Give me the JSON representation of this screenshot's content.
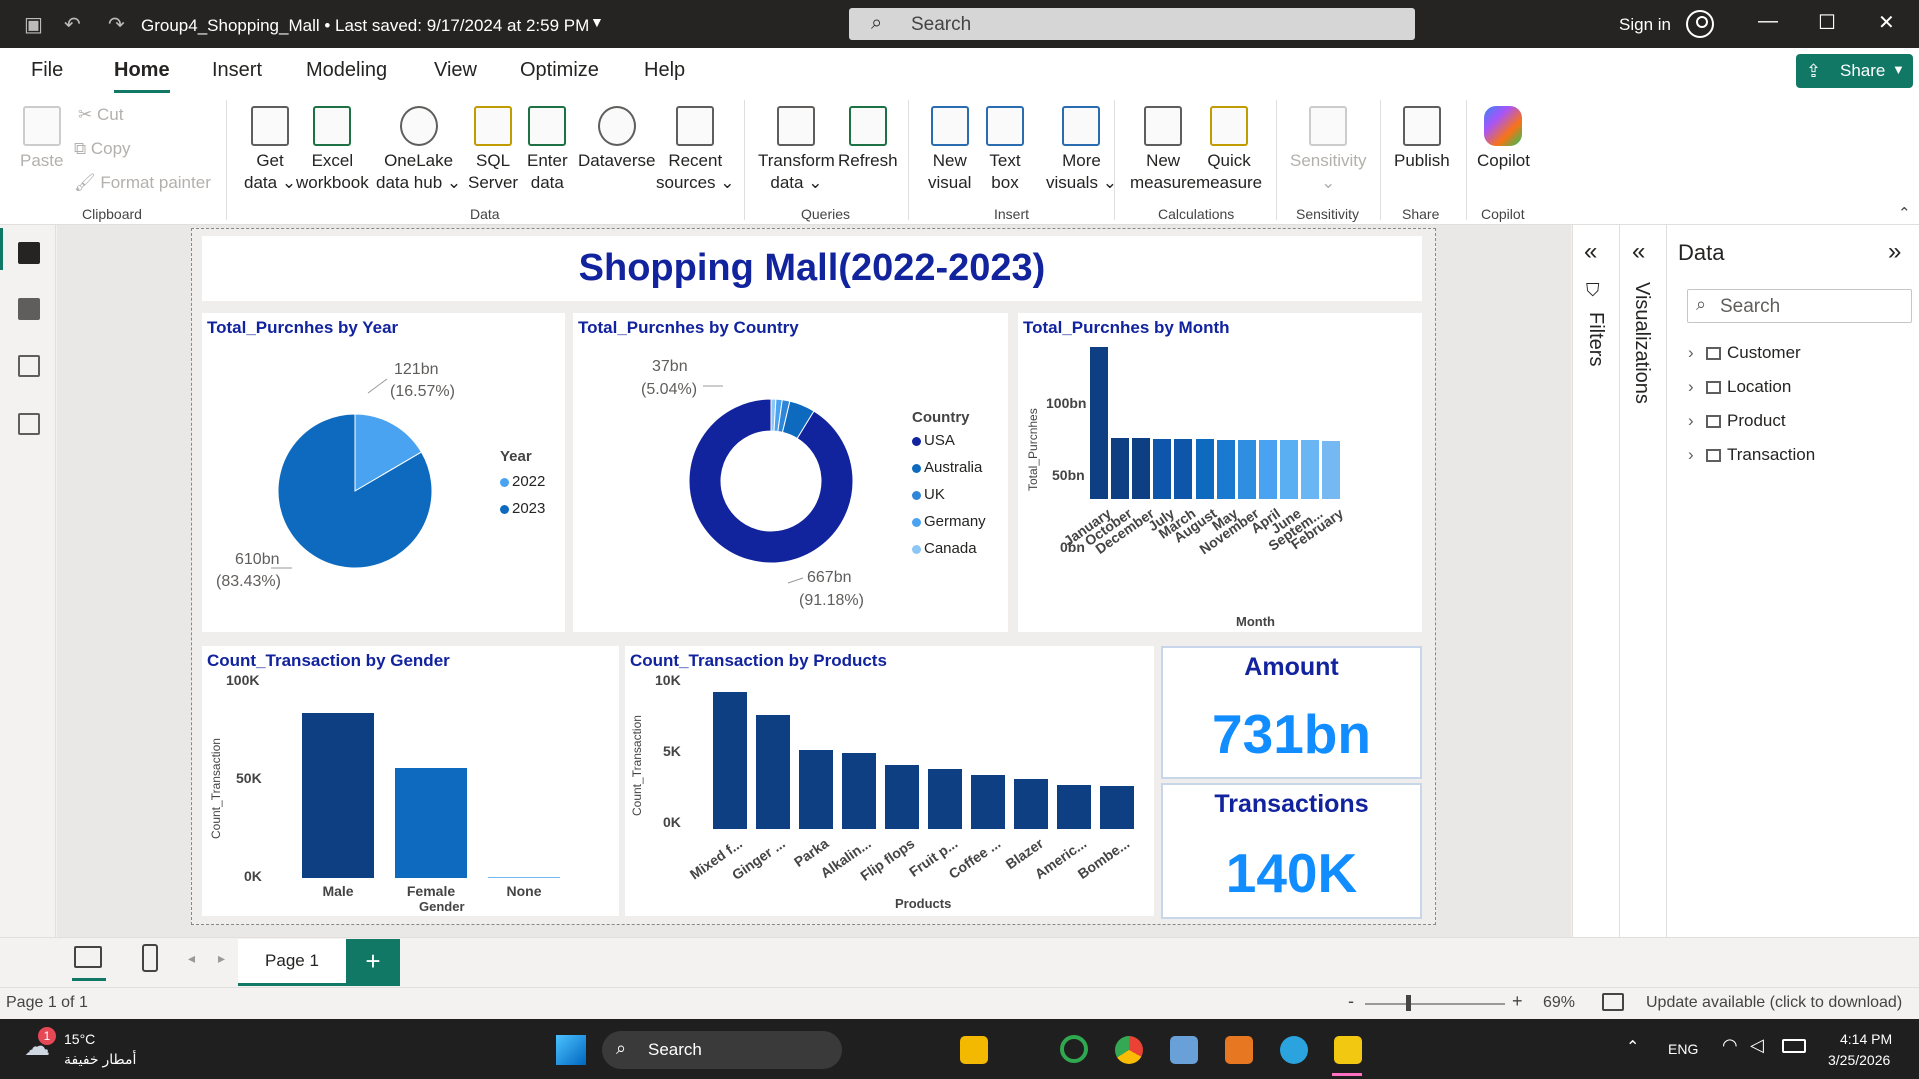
{
  "titlebar": {
    "doc_title": "Group4_Shopping_Mall • Last saved: 9/17/2024 at 2:59 PM",
    "search_placeholder": "Search",
    "signin": "Sign in"
  },
  "menu": {
    "items": [
      "File",
      "Home",
      "Insert",
      "Modeling",
      "View",
      "Optimize",
      "Help"
    ],
    "active": "Home",
    "share_label": "Share"
  },
  "ribbon": {
    "clipboard": {
      "paste": "Paste",
      "cut": "Cut",
      "copy": "Copy",
      "format_painter": "Format painter",
      "group": "Clipboard"
    },
    "data": {
      "get_data": [
        "Get",
        "data"
      ],
      "excel": [
        "Excel",
        "workbook"
      ],
      "onelake": [
        "OneLake",
        "data hub"
      ],
      "sql": [
        "SQL",
        "Server"
      ],
      "enter": [
        "Enter",
        "data"
      ],
      "dataverse": "Dataverse",
      "recent": [
        "Recent",
        "sources"
      ],
      "group": "Data"
    },
    "queries": {
      "transform": [
        "Transform",
        "data"
      ],
      "refresh": "Refresh",
      "group": "Queries"
    },
    "insert": {
      "new_visual": [
        "New",
        "visual"
      ],
      "text_box": [
        "Text",
        "box"
      ],
      "more_visuals": [
        "More",
        "visuals"
      ],
      "group": "Insert"
    },
    "calculations": {
      "new_measure": [
        "New",
        "measure"
      ],
      "quick_measure": [
        "Quick",
        "measure"
      ],
      "group": "Calculations"
    },
    "sensitivity": {
      "label": "Sensitivity",
      "group": "Sensitivity"
    },
    "share": {
      "publish": "Publish",
      "group": "Share"
    },
    "copilot": {
      "label": "Copilot",
      "group": "Copilot"
    }
  },
  "report": {
    "title": "Shopping Mall(2022-2023)",
    "pie": {
      "title": "Total_Purcnhes by Year",
      "label_small": [
        "121bn",
        "(16.57%)"
      ],
      "label_large": [
        "610bn",
        "(83.43%)"
      ],
      "legend_title": "Year",
      "legend": [
        "2022",
        "2023"
      ]
    },
    "donut": {
      "title": "Total_Purcnhes by Country",
      "label_small": [
        "37bn",
        "(5.04%)"
      ],
      "label_large": [
        "667bn",
        "(91.18%)"
      ],
      "legend_title": "Country",
      "legend": [
        "USA",
        "Australia",
        "UK",
        "Germany",
        "Canada"
      ]
    },
    "month_chart": {
      "title": "Total_Purcnhes by Month",
      "y_title": "Total_Purcnhes",
      "x_title": "Month",
      "y_ticks": [
        "100bn",
        "50bn",
        "0bn"
      ]
    },
    "gender_chart": {
      "title": "Count_Transaction by Gender",
      "y_title": "Count_Transaction",
      "x_title": "Gender",
      "y_ticks": [
        "100K",
        "50K",
        "0K"
      ]
    },
    "products_chart": {
      "title": "Count_Transaction by Products",
      "y_title": "Count_Transaction",
      "x_title": "Products",
      "y_ticks": [
        "10K",
        "5K",
        "0K"
      ]
    },
    "cards": {
      "amount_title": "Amount",
      "amount_value": "731bn",
      "tx_title": "Transactions",
      "tx_value": "140K"
    }
  },
  "chart_data": [
    {
      "type": "pie",
      "title": "Total_Purcnhes by Year",
      "categories": [
        "2022",
        "2023"
      ],
      "values": [
        121,
        610
      ],
      "percent": [
        16.57,
        83.43
      ],
      "unit": "bn",
      "legend": "right"
    },
    {
      "type": "pie",
      "donut": true,
      "title": "Total_Purcnhes by Country",
      "categories": [
        "USA",
        "Australia",
        "UK",
        "Germany",
        "Canada"
      ],
      "values": [
        667,
        37,
        11,
        9,
        7
      ],
      "percent": [
        91.18,
        5.04,
        1.5,
        1.25,
        1.03
      ],
      "unit": "bn",
      "legend": "right"
    },
    {
      "type": "bar",
      "title": "Total_Purcnhes by Month",
      "xlabel": "Month",
      "ylabel": "Total_Purcnhes",
      "categories": [
        "January",
        "October",
        "December",
        "July",
        "March",
        "August",
        "May",
        "November",
        "April",
        "June",
        "Septem...",
        "February"
      ],
      "values": [
        134,
        54,
        54,
        53,
        53,
        53,
        52,
        52,
        52,
        52,
        52,
        51
      ],
      "unit": "bn",
      "ylim": [
        0,
        135
      ]
    },
    {
      "type": "bar",
      "title": "Count_Transaction by Gender",
      "xlabel": "Gender",
      "ylabel": "Count_Transaction",
      "categories": [
        "Male",
        "Female",
        "None"
      ],
      "values": [
        84000,
        56000,
        0
      ],
      "ylim": [
        0,
        100000
      ]
    },
    {
      "type": "bar",
      "title": "Count_Transaction by Products",
      "xlabel": "Products",
      "ylabel": "Count_Transaction",
      "categories": [
        "Mixed f...",
        "Ginger ...",
        "Parka",
        "Alkalin...",
        "Flip flops",
        "Fruit p...",
        "Coffee ...",
        "Blazer",
        "Americ...",
        "Bombe..."
      ],
      "values": [
        9600,
        8000,
        5500,
        5300,
        4500,
        4200,
        3800,
        3500,
        3100,
        3000
      ],
      "ylim": [
        0,
        10000
      ]
    }
  ],
  "panes": {
    "filters": "Filters",
    "visualizations": "Visualizations",
    "data_title": "Data",
    "data_search": "Search",
    "tables": [
      "Customer",
      "Location",
      "Product",
      "Transaction"
    ]
  },
  "pages": {
    "tab": "Page 1",
    "add": "+"
  },
  "status": {
    "page": "Page 1 of 1",
    "zoom": "69%",
    "update": "Update available (click to download)"
  },
  "taskbar": {
    "weather_temp": "15°C",
    "weather_desc": "أمطار خفيفة",
    "search": "Search",
    "lang": "ENG",
    "time": "4:14 PM",
    "date": "3/25/2026",
    "badge": "1"
  },
  "colors": {
    "dark": "#12239e",
    "primary": "#0d6abf",
    "light": "#4aa3f0",
    "lighter": "#76b9f2",
    "accent": "#117865"
  }
}
